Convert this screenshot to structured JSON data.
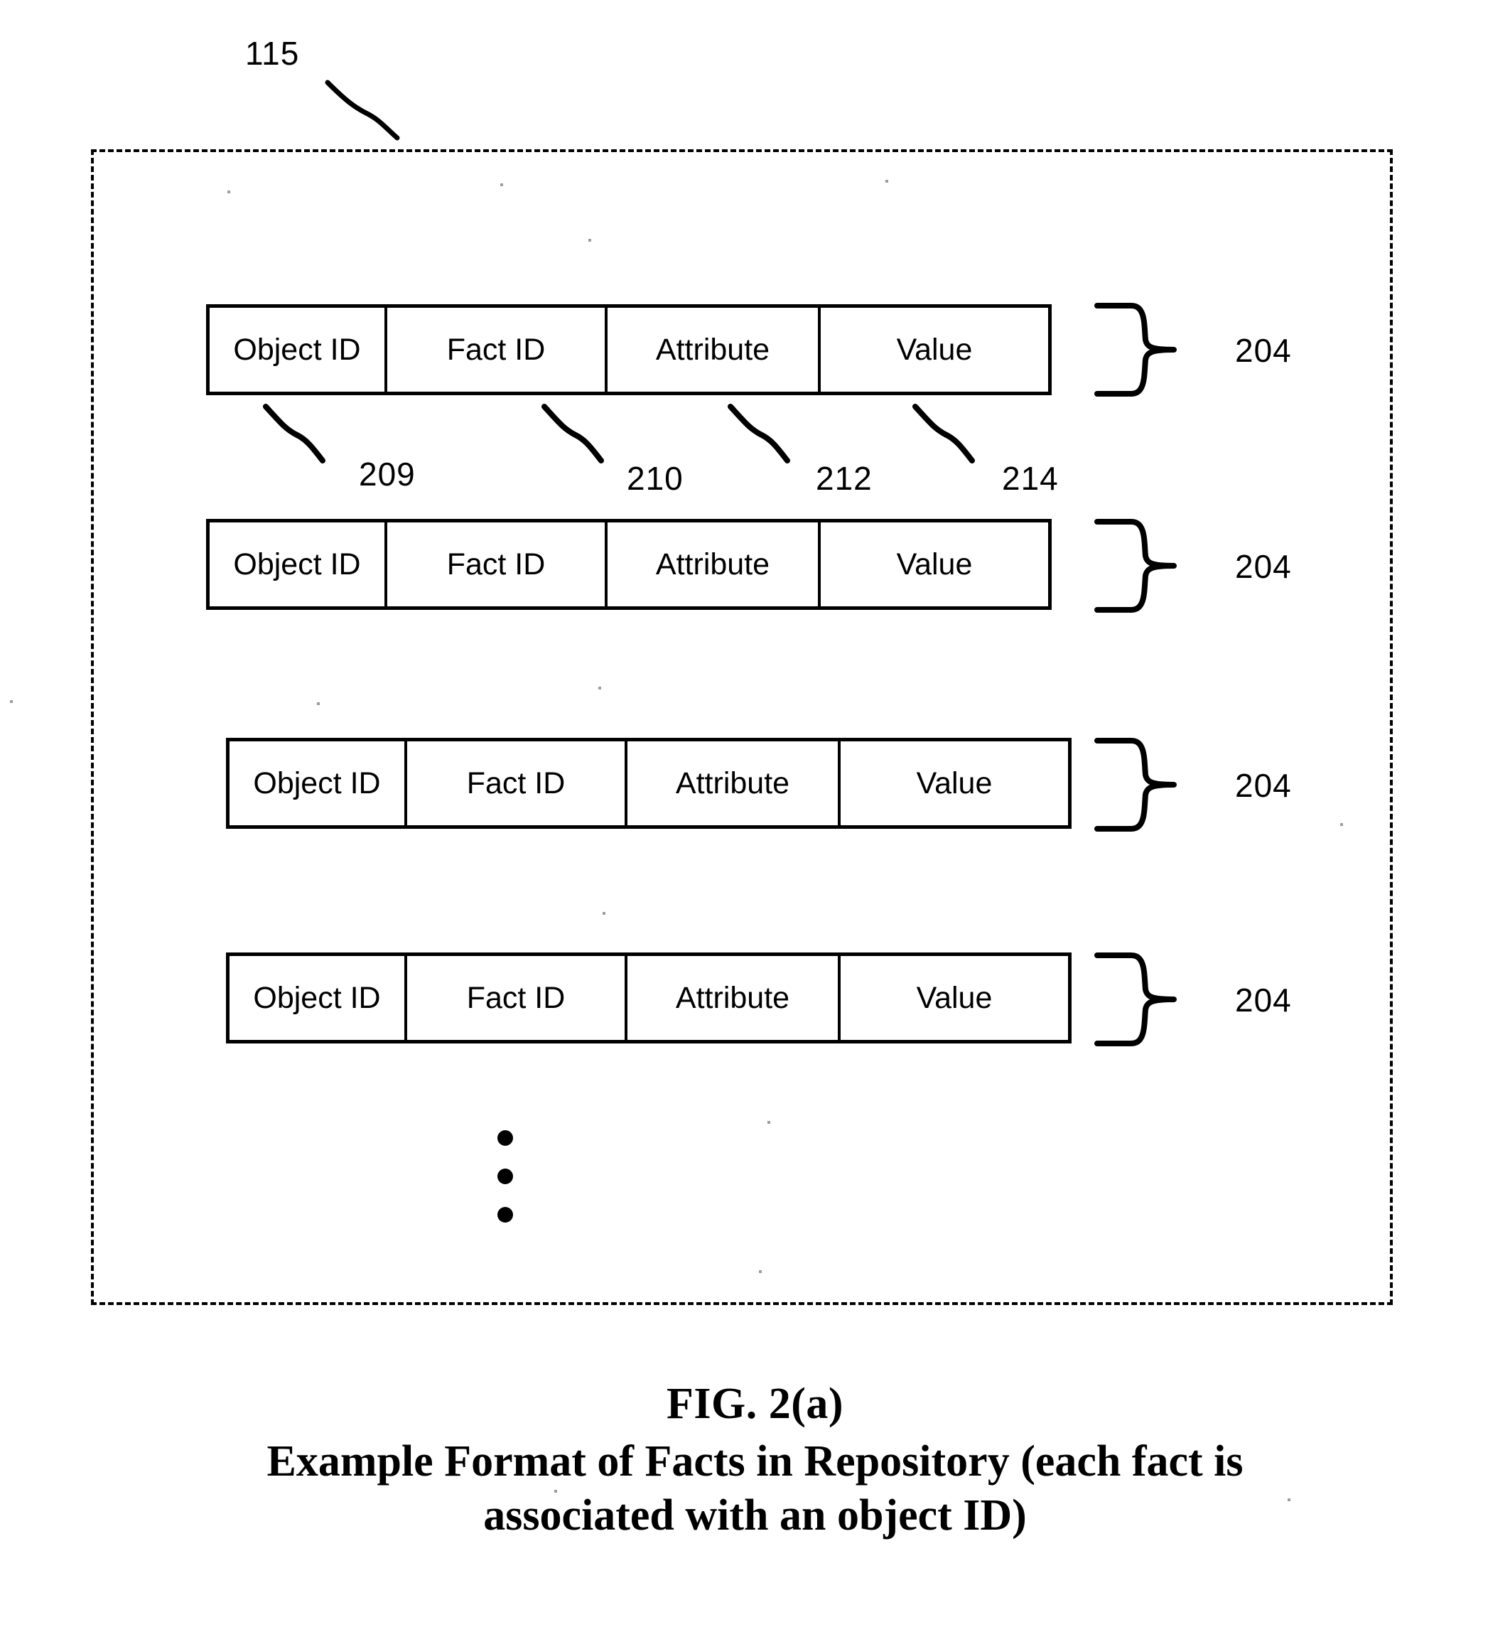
{
  "figure": {
    "repository_ref": "115",
    "row_ref": "204",
    "field_refs": {
      "object_id": "209",
      "fact_id": "210",
      "attribute": "212",
      "value": "214"
    },
    "ellipsis": "vertical-ellipsis"
  },
  "columns": {
    "object_id": "Object ID",
    "fact_id": "Fact ID",
    "attribute": "Attribute",
    "value": "Value"
  },
  "rows": [
    {
      "id": "row-1",
      "ref": "204",
      "cells": [
        "Object ID",
        "Fact ID",
        "Attribute",
        "Value"
      ]
    },
    {
      "id": "row-2",
      "ref": "204",
      "cells": [
        "Object ID",
        "Fact ID",
        "Attribute",
        "Value"
      ]
    },
    {
      "id": "row-3",
      "ref": "204",
      "cells": [
        "Object ID",
        "Fact ID",
        "Attribute",
        "Value"
      ]
    },
    {
      "id": "row-4",
      "ref": "204",
      "cells": [
        "Object ID",
        "Fact ID",
        "Attribute",
        "Value"
      ]
    }
  ],
  "caption": {
    "figure_number": "FIG. 2(a)",
    "description": "Example Format of Facts in Repository (each fact is associated with an object ID)"
  },
  "colors": {
    "ink": "#000000",
    "paper": "#ffffff"
  }
}
